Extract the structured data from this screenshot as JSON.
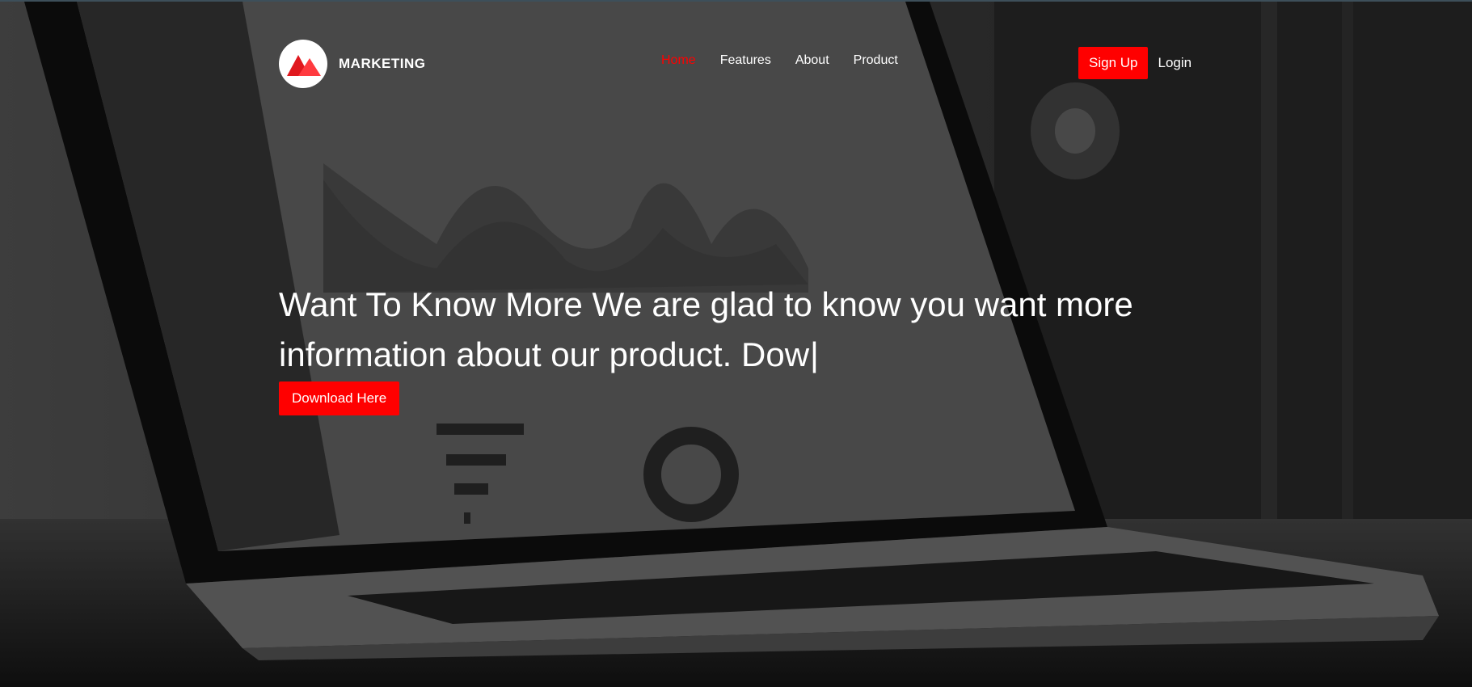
{
  "brand": {
    "name": "MARKETING",
    "logo_icon": "mountain-logo-icon",
    "accent_color": "#ff0000"
  },
  "nav": {
    "items": [
      {
        "label": "Home",
        "active": true
      },
      {
        "label": "Features",
        "active": false
      },
      {
        "label": "About",
        "active": false
      },
      {
        "label": "Product",
        "active": false
      }
    ]
  },
  "auth": {
    "signup_label": "Sign Up",
    "login_label": "Login"
  },
  "hero": {
    "headline": "Want To Know More We are glad to know you want more information about our product. Dow",
    "caret": "|",
    "cta_label": "Download Here"
  }
}
